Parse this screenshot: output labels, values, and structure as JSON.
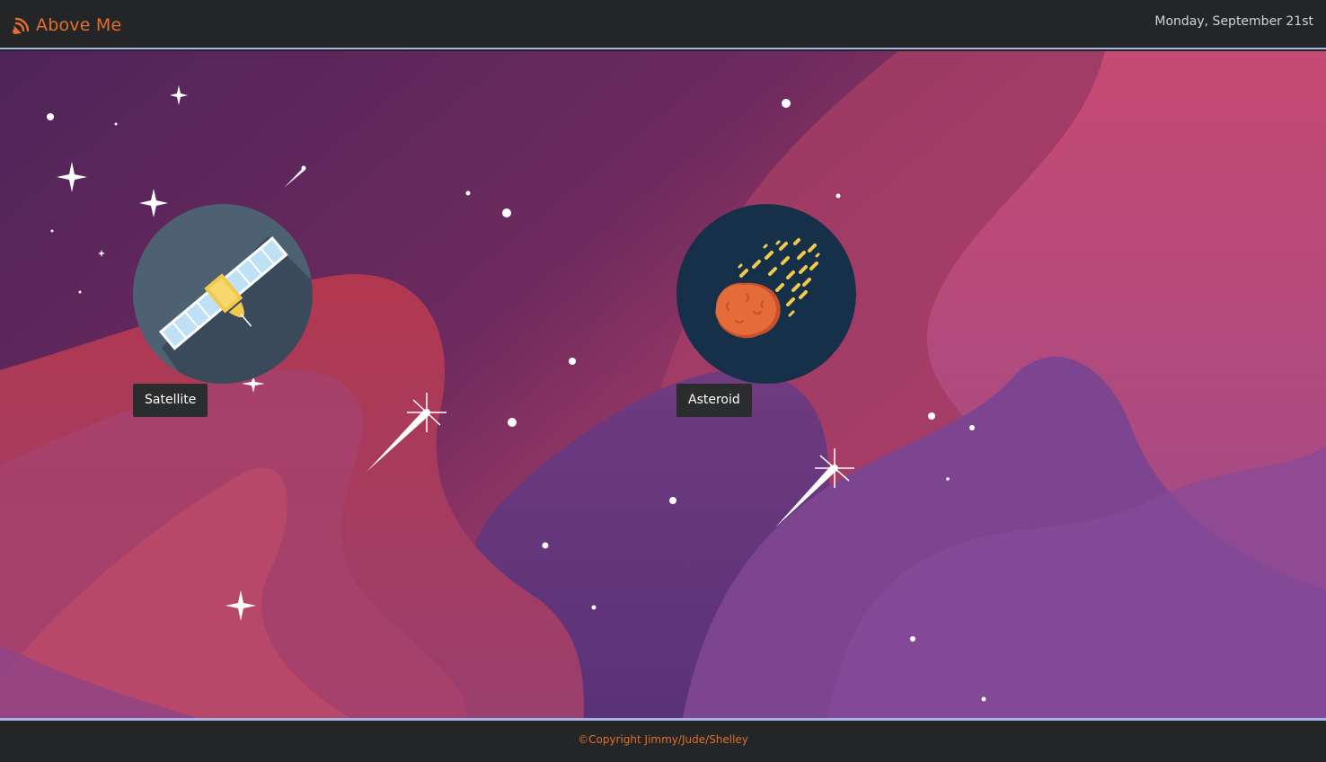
{
  "header": {
    "app_name": "Above Me",
    "app_icon": "satellite-dish-icon",
    "date": "Monday, September 21st"
  },
  "items": [
    {
      "label": "Satellite",
      "icon": "satellite-icon"
    },
    {
      "label": "Asteroid",
      "icon": "asteroid-icon"
    }
  ],
  "footer": {
    "copyright": "©Copyright Jimmy/Jude/Shelley"
  },
  "colors": {
    "accent": "#e36f2c",
    "bar": "#232526",
    "divider": "#a9b4e6",
    "satellite_disc": "#4e6172",
    "asteroid_disc": "#173049"
  }
}
